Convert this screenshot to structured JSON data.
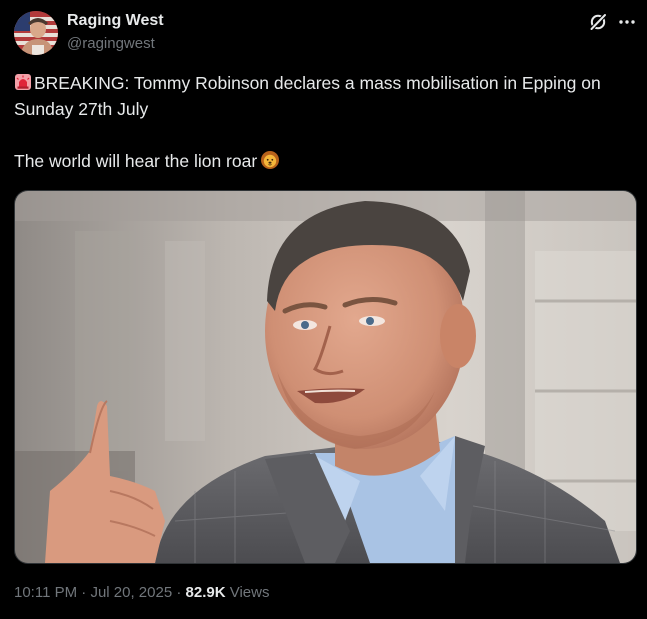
{
  "author": {
    "name": "Raging West",
    "handle": "@ragingwest",
    "avatar_icon": "avatar-flag-portrait"
  },
  "header_actions": {
    "grok_icon": "grok-icon",
    "more_icon": "more-horizontal-icon"
  },
  "tweet": {
    "line1": "BREAKING: Tommy Robinson declares a mass mobilisation in Epping on Sunday 27th July",
    "line2": "The world will hear the lion roar",
    "emoji_1": "siren-emoji",
    "emoji_2": "lion-face-emoji"
  },
  "media": {
    "type": "photo",
    "description_icon": "tweet-photo"
  },
  "meta": {
    "time": "10:11 PM",
    "separator": " · ",
    "date": "Jul 20, 2025",
    "views_count": "82.9K",
    "views_label": "Views"
  },
  "colors": {
    "background": "#000000",
    "text": "#e7e9ea",
    "secondary": "#71767b",
    "border": "#2f3336"
  }
}
